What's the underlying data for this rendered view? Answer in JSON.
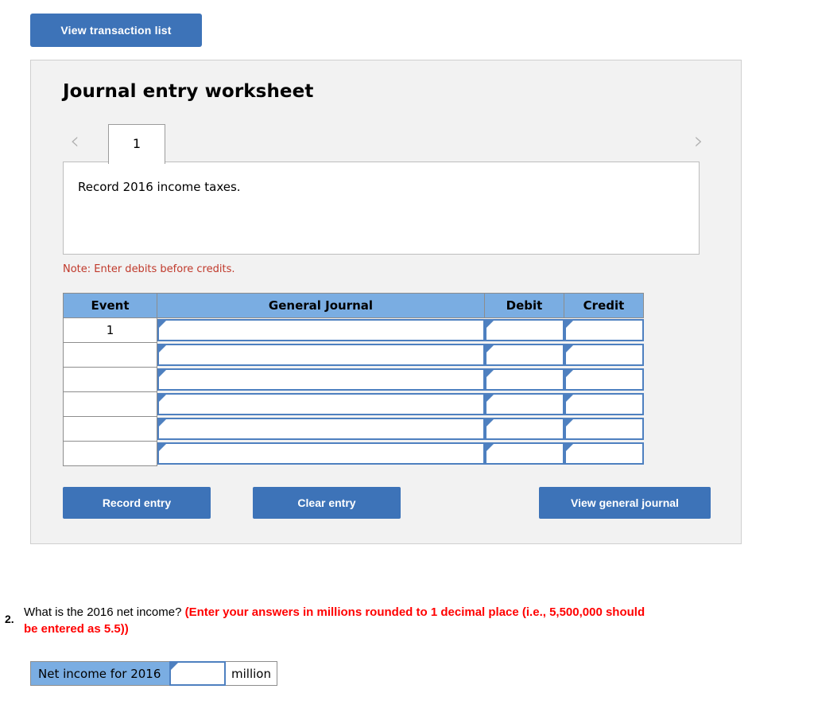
{
  "toolbar": {
    "view_transaction_list_label": "View transaction list"
  },
  "worksheet": {
    "title": "Journal entry worksheet",
    "nav": {
      "prev_icon": "chevron-left-icon",
      "next_icon": "chevron-right-icon",
      "prev_glyph": "‹",
      "next_glyph": "›"
    },
    "tabs": [
      {
        "label": "1",
        "active": true
      }
    ],
    "description": "Record 2016 income taxes.",
    "note": "Note: Enter debits before credits.",
    "table": {
      "columns": [
        "Event",
        "General Journal",
        "Debit",
        "Credit"
      ],
      "rows": [
        {
          "event": "1",
          "general_journal": "",
          "debit": "",
          "credit": ""
        },
        {
          "event": "",
          "general_journal": "",
          "debit": "",
          "credit": ""
        },
        {
          "event": "",
          "general_journal": "",
          "debit": "",
          "credit": ""
        },
        {
          "event": "",
          "general_journal": "",
          "debit": "",
          "credit": ""
        },
        {
          "event": "",
          "general_journal": "",
          "debit": "",
          "credit": ""
        },
        {
          "event": "",
          "general_journal": "",
          "debit": "",
          "credit": ""
        }
      ]
    },
    "buttons": {
      "record_entry": "Record entry",
      "clear_entry": "Clear entry",
      "view_general_journal": "View general journal"
    }
  },
  "question": {
    "number": "2.",
    "prompt": "What is the 2016 net income? ",
    "hint": "(Enter your answers in millions rounded to 1 decimal place (i.e., 5,500,000 should be entered as 5.5))",
    "answer": {
      "label": "Net income for 2016",
      "value": "",
      "unit": "million"
    }
  },
  "colors": {
    "button_blue": "#3d73b8",
    "header_blue": "#7aadE2",
    "field_border_blue": "#4e80c0",
    "panel_gray": "#f2f2f2",
    "note_red": "#c0392b",
    "hint_red": "#ff0000"
  }
}
